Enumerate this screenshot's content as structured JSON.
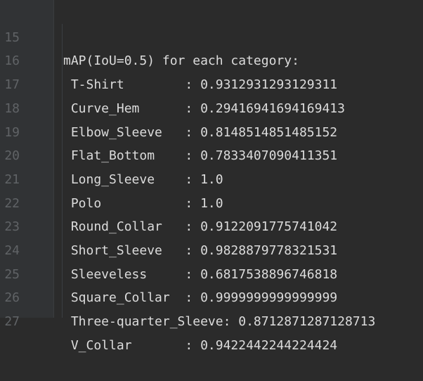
{
  "editor": {
    "lines": [
      {
        "number": "15",
        "text": "mAP(IoU=0.5) for each category:"
      },
      {
        "number": "16",
        "text": " T-Shirt        : 0.9312931293129311"
      },
      {
        "number": "17",
        "text": " Curve_Hem      : 0.29416941694169413"
      },
      {
        "number": "18",
        "text": " Elbow_Sleeve   : 0.8148514851485152"
      },
      {
        "number": "19",
        "text": " Flat_Bottom    : 0.7833407090411351"
      },
      {
        "number": "20",
        "text": " Long_Sleeve    : 1.0"
      },
      {
        "number": "21",
        "text": " Polo           : 1.0"
      },
      {
        "number": "22",
        "text": " Round_Collar   : 0.9122091775741042"
      },
      {
        "number": "23",
        "text": " Short_Sleeve   : 0.9828879778321531"
      },
      {
        "number": "24",
        "text": " Sleeveless     : 0.6817538896746818"
      },
      {
        "number": "25",
        "text": " Square_Collar  : 0.9999999999999999"
      },
      {
        "number": "26",
        "text": " Three-quarter_Sleeve: 0.8712871287128713"
      },
      {
        "number": "27",
        "text": " V_Collar       : 0.9422442244224424"
      }
    ]
  },
  "colors": {
    "background": "#2b2b2b",
    "gutter": "#313335",
    "line_number": "#606366",
    "text": "#dcdcdc"
  }
}
